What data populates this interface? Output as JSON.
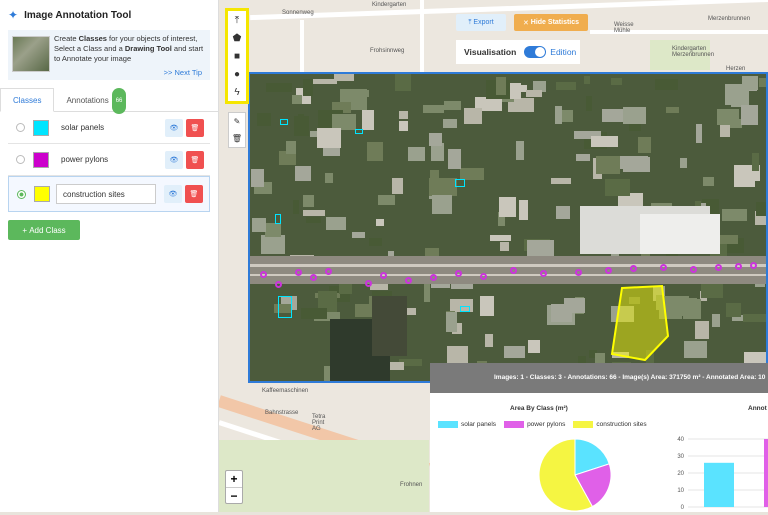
{
  "app": {
    "title": "Image Annotation Tool"
  },
  "tip": {
    "line1": "Create ",
    "bold1": "Classes",
    "line2": " for your objects of interest, Select a Class and a ",
    "bold2": "Drawing Tool",
    "line3": " and start to Annotate your image",
    "next": ">> Next Tip"
  },
  "tabs": [
    {
      "label": "Classes"
    },
    {
      "label": "Annotations",
      "badge": "66"
    }
  ],
  "classes": [
    {
      "name": "solar panels",
      "color": "#00e5ff"
    },
    {
      "name": "power pylons",
      "color": "#cc00cc"
    },
    {
      "name": "construction sites",
      "color": "#ffff00"
    }
  ],
  "add_class": "Add Class",
  "toolbar": {
    "export": "Export",
    "hide_stats": "Hide Statistics"
  },
  "visualisation": {
    "label": "Visualisation",
    "mode": "Edition"
  },
  "zoom": {
    "in": "+",
    "out": "−"
  },
  "map_labels": [
    "Sonnenweg",
    "Kindergarten",
    "Frohsinnweg",
    "Landbergstrasse",
    "Merzenbrunnen",
    "Kindergarten Merzenbrunnen",
    "Weisse Mühle",
    "Schulstrasse",
    "Herzen",
    "Kaffeemaschinen",
    "Bahnstrasse",
    "Tetra Print AG",
    "Kindergarten",
    "Hiebenstrasse",
    "Zürcherstrasse",
    "Frohnen"
  ],
  "stats": {
    "summary": "Images: 1 - Classes: 3 - Annotations: 66 - Image(s) Area: 371750 m² - Annotated Area: 10",
    "pie_title": "Area By Class (m²)",
    "bar_title": "Annot",
    "bar_ticks": [
      "40",
      "30",
      "20",
      "10",
      "0"
    ]
  },
  "chart_data": {
    "type": "pie",
    "title": "Area By Class (m²)",
    "categories": [
      "solar panels",
      "power pylons",
      "construction sites"
    ],
    "values": [
      20,
      22,
      58
    ],
    "colors": [
      "#5ae3ff",
      "#e060e8",
      "#f5f542"
    ]
  },
  "bar_chart": {
    "type": "bar",
    "values": [
      26
    ],
    "ylim": [
      0,
      40
    ],
    "colors": [
      "#5ae3ff"
    ]
  }
}
